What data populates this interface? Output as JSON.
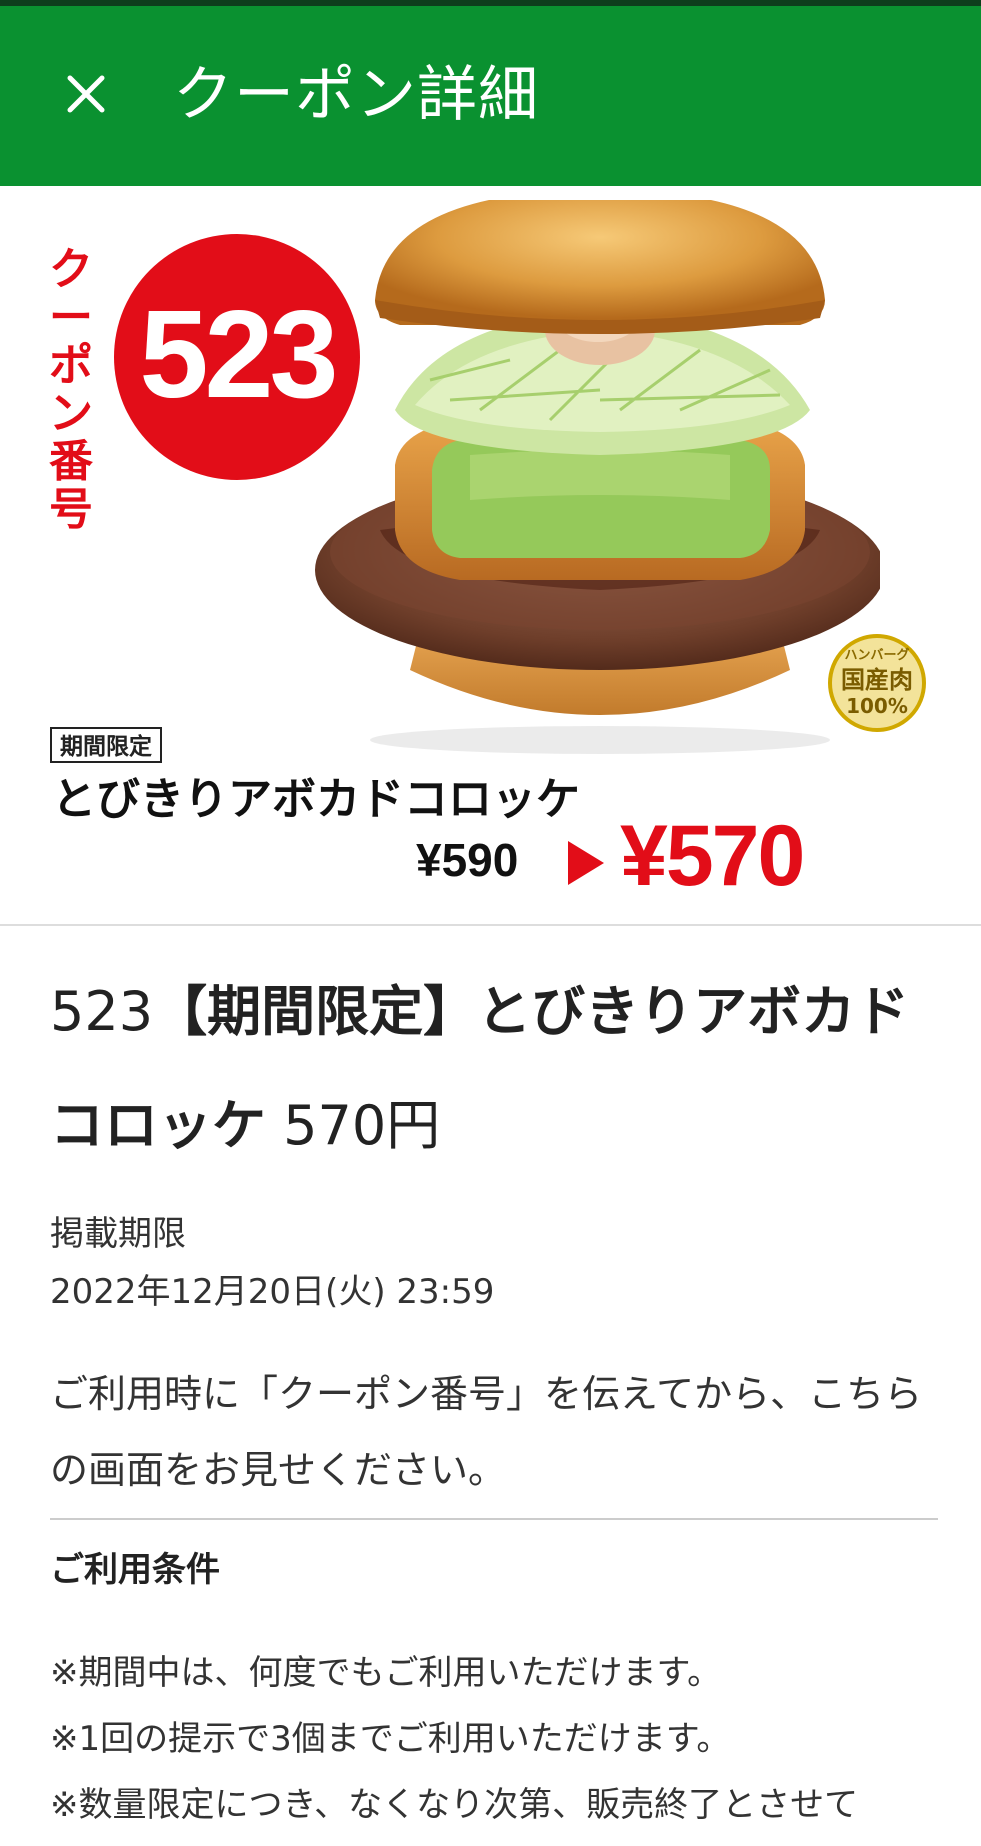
{
  "header": {
    "title": "クーポン詳細",
    "close_icon": "close-icon",
    "bg_color": "#0a9130"
  },
  "banner": {
    "coupon_label": "クーポン番号",
    "coupon_number": "523",
    "limited_tag": "期間限定",
    "product_name": "とびきりアボカドコロッケ",
    "old_price": "¥590",
    "new_price": "¥570",
    "badge": {
      "top": "ハンバーグ",
      "middle": "国産肉",
      "bottom": "100%"
    },
    "accent_color": "#e20d18"
  },
  "detail": {
    "number": "523",
    "title_bold": "【期間限定】とびきりアボカドコロッケ",
    "price": "570円",
    "period_label": "掲載期限",
    "period_value": "2022年12月20日(火) 23:59",
    "instruction": "ご利用時に「クーポン番号」を伝えてから、こちらの画面をお見せください。"
  },
  "conditions": {
    "heading": "ご利用条件",
    "items": [
      "※期間中は、何度でもご利用いただけます。",
      "※1回の提示で3個までご利用いただけます。",
      "※数量限定につき、なくなり次第、販売終了とさせて"
    ]
  }
}
